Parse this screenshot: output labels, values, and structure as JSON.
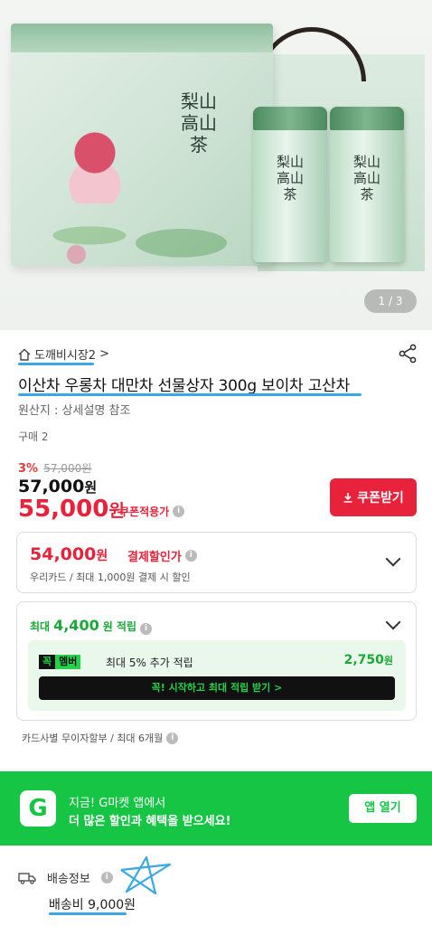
{
  "gallery": {
    "page_indicator": "1 / 3",
    "box_text": "梨山高山茶",
    "can_text": "梨山高山茶"
  },
  "store": {
    "name": "도깨비시장2",
    "chevron": ">"
  },
  "product": {
    "title": "이산차 우롱차 대만차 선물상자 300g 보이차 고산차",
    "origin": "원산지 : 상세설명 참조",
    "purchase_count": "구매 2"
  },
  "price": {
    "discount_rate": "3%",
    "list_price_struck": "57,000원",
    "original_value": "57,000",
    "original_unit": "원",
    "coupon_value": "55,000",
    "coupon_unit": "원",
    "coupon_label": "쿠폰적용가",
    "coupon_button": "쿠폰받기"
  },
  "payment_discount": {
    "value": "54,000",
    "unit": "원",
    "label": "결제할인가",
    "sub": "우리카드 / 최대 1,000원 결제 시 할인"
  },
  "reward": {
    "prefix": "최대",
    "value": "4,400",
    "unit": "원 적립",
    "member_badge_1": "꼭",
    "member_badge_2": "멤버",
    "member_text": "최대 5% 추가 적립",
    "member_amount": "2,750",
    "member_amount_unit": "원",
    "member_button": "꼭! 시작하고 최대 적립 받기 >"
  },
  "installment": "카드사별 무이자할부 / 최대 6개월",
  "app_banner": {
    "logo": "G",
    "line1": "지금! G마켓 앱에서",
    "line2": "더 많은 할인과 혜택을 받으세요!",
    "button": "앱 열기"
  },
  "shipping": {
    "label": "배송정보",
    "fee": "배송비 9,000원"
  },
  "colors": {
    "accent_red": "#e8223a",
    "accent_green": "#16c544",
    "annotation_blue": "#3aa7e6"
  }
}
